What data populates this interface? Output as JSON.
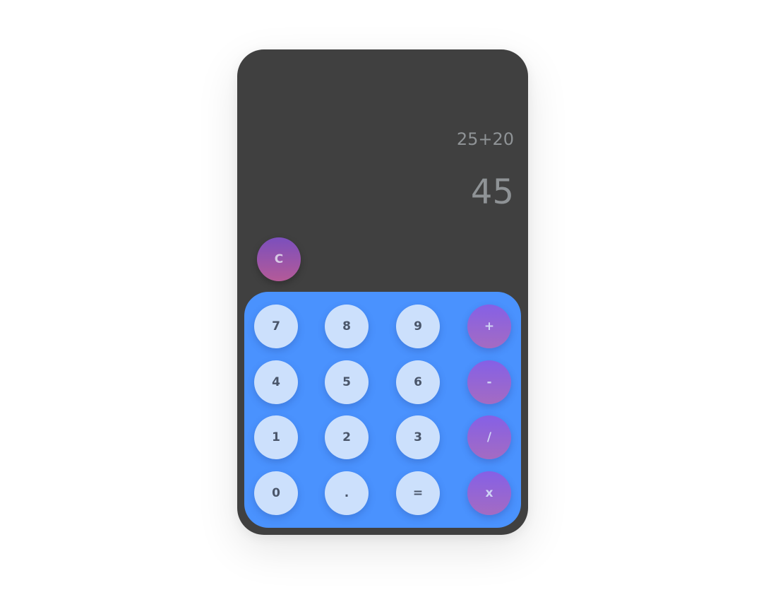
{
  "display": {
    "expression": "25+20",
    "result": "45"
  },
  "clear_label": "C",
  "keys": {
    "k7": "7",
    "k8": "8",
    "k9": "9",
    "plus": "+",
    "k4": "4",
    "k5": "5",
    "k6": "6",
    "minus": "-",
    "k1": "1",
    "k2": "2",
    "k3": "3",
    "divide": "/",
    "k0": "0",
    "dot": ".",
    "equals": "=",
    "multiply": "x"
  },
  "colors": {
    "body": "#404040",
    "keypad": "#4a92fe",
    "number_key": "#cce0fc",
    "operator_key_top": "#8560e6",
    "operator_key_bottom": "#a46bc2",
    "clear_key_top": "#7b4fbd",
    "clear_key_bottom": "#b45a98",
    "display_text": "#8f9396"
  }
}
